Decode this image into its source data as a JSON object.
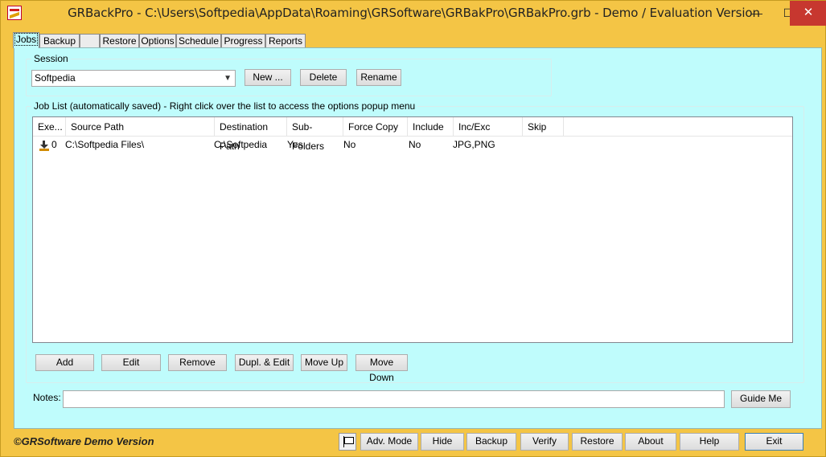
{
  "window": {
    "title": "GRBackPro - C:\\Users\\Softpedia\\AppData\\Roaming\\GRSoftware\\GRBakPro\\GRBakPro.grb - Demo / Evaluation Version",
    "min_glyph": "—",
    "max_glyph": "☐",
    "close_glyph": "✕"
  },
  "tabs": [
    {
      "label": "Jobs",
      "active": true
    },
    {
      "label": "Backup"
    },
    {
      "label": ""
    },
    {
      "label": "Restore"
    },
    {
      "label": "Options"
    },
    {
      "label": "Schedule"
    },
    {
      "label": "Progress"
    },
    {
      "label": "Reports"
    }
  ],
  "session": {
    "group_label": "Session",
    "selected": "Softpedia",
    "new_label": "New ...",
    "delete_label": "Delete",
    "rename_label": "Rename"
  },
  "job_list": {
    "group_label": "Job List (automatically saved) - Right click over the list to access the options popup menu",
    "columns": [
      "Exe...",
      "Source Path",
      "Destination Path",
      "Sub-Folders",
      "Force Copy",
      "Include",
      "Inc/Exc",
      "Skip"
    ],
    "rows": [
      {
        "exe": "0",
        "source": "C:\\Softpedia Files\\",
        "dest": "C:\\Softpedia",
        "subfolders": "Yes",
        "force_copy": "No",
        "include": "No",
        "inc_exc": "JPG,PNG",
        "skip": ""
      }
    ],
    "buttons": {
      "add": "Add",
      "edit": "Edit",
      "remove": "Remove",
      "dupl_edit": "Dupl. & Edit",
      "move_up": "Move Up",
      "move_down": "Move Down"
    }
  },
  "notes": {
    "label": "Notes:",
    "value": "",
    "guide_label": "Guide Me"
  },
  "footer": {
    "copyright": "©GRSoftware Demo Version",
    "buttons": {
      "adv_mode": "Adv. Mode",
      "hide": "Hide",
      "backup": "Backup",
      "verify": "Verify",
      "restore": "Restore",
      "about": "About",
      "help": "Help",
      "exit": "Exit"
    }
  }
}
